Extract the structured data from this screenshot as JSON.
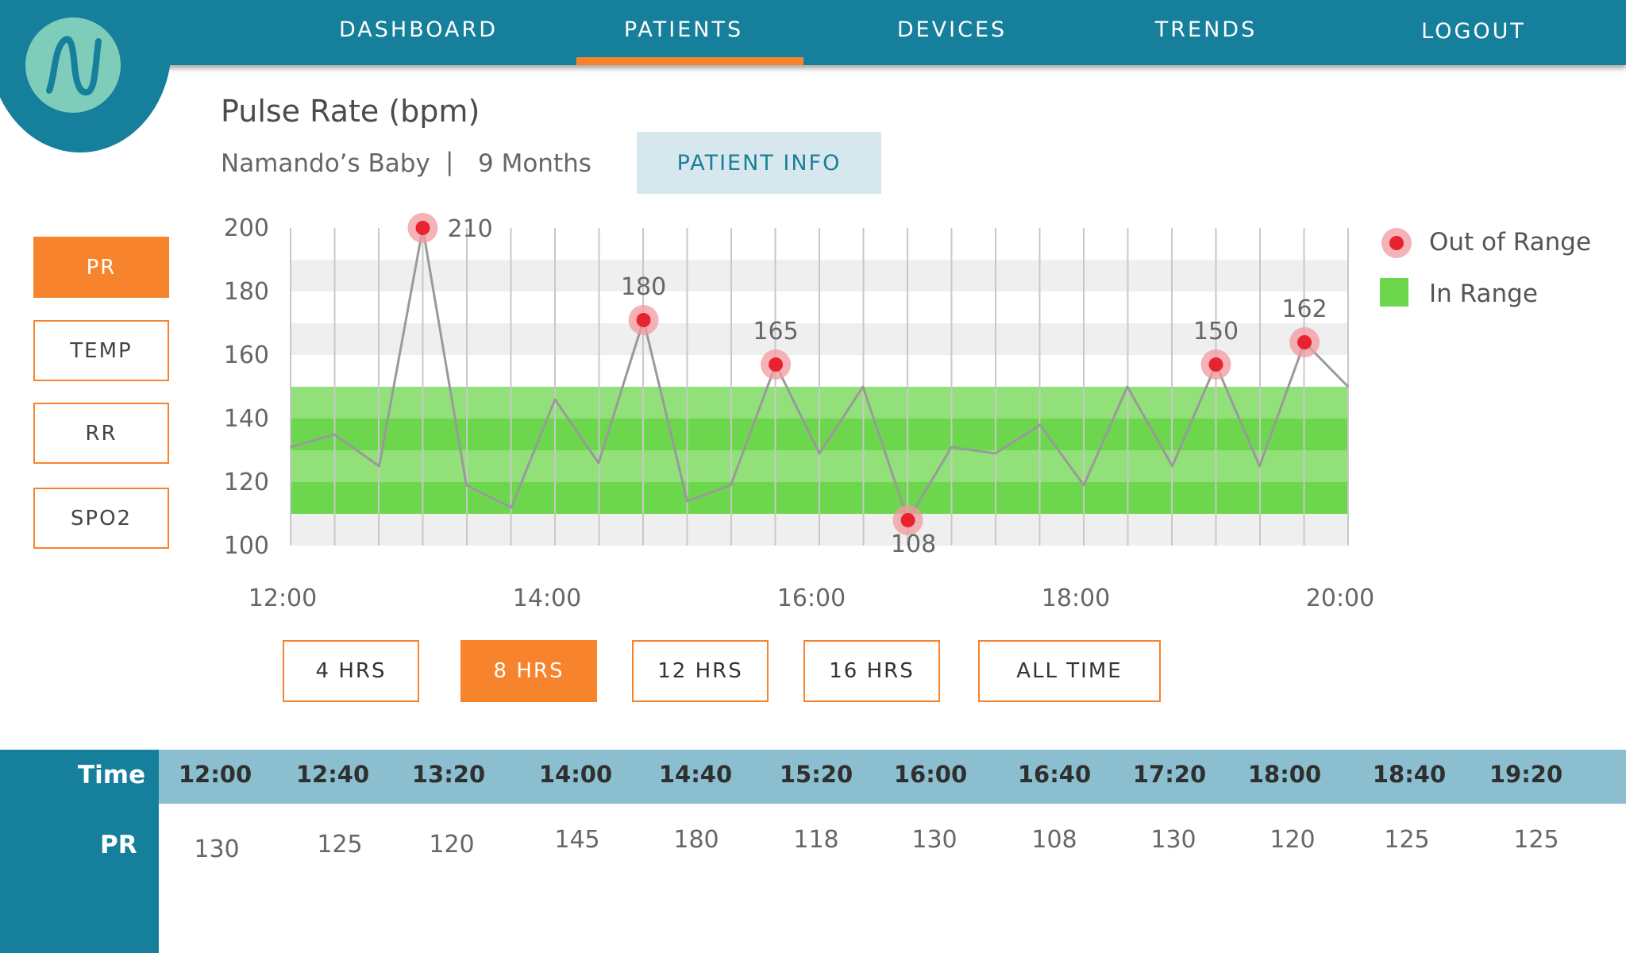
{
  "nav": {
    "items": [
      {
        "label": "DASHBOARD",
        "active": false
      },
      {
        "label": "PATIENTS",
        "active": true
      },
      {
        "label": "DEVICES",
        "active": false
      },
      {
        "label": "TRENDS",
        "active": false
      },
      {
        "label": "LOGOUT",
        "active": false
      }
    ]
  },
  "header": {
    "title": "Pulse Rate (bpm)",
    "patient_name": "Namando’s Baby",
    "separator": "|",
    "patient_age": "9 Months",
    "patient_info_label": "PATIENT INFO"
  },
  "metrics": [
    {
      "label": "PR",
      "active": true
    },
    {
      "label": "TEMP",
      "active": false
    },
    {
      "label": "RR",
      "active": false
    },
    {
      "label": "SPO2",
      "active": false
    }
  ],
  "legend": {
    "out_of_range": "Out of Range",
    "in_range": "In Range"
  },
  "colors": {
    "brand": "#167f9b",
    "accent": "#f7832c",
    "table_header": "#8bbfcf",
    "in_range_light": "#92e07a",
    "in_range_dark": "#6cd64c",
    "out_of_range_dot": "#e8232f",
    "out_of_range_halo": "#f29aa0",
    "line": "#9a9a9a"
  },
  "chart_data": {
    "type": "line",
    "ylim": [
      100,
      200
    ],
    "yticks": [
      100,
      120,
      140,
      160,
      180,
      200
    ],
    "x_tick_labels": [
      "12:00",
      "14:00",
      "16:00",
      "18:00",
      "20:00"
    ],
    "x_ticks_hours": [
      12,
      14,
      16,
      18,
      20
    ],
    "xlim_hours": [
      12,
      20
    ],
    "grid": true,
    "in_range": [
      110,
      150
    ],
    "series": [
      {
        "x_hours": [
          12.0,
          12.33,
          12.67,
          13.0,
          13.33,
          13.67,
          14.0,
          14.33,
          14.67,
          15.0,
          15.33,
          15.67,
          16.0,
          16.33,
          16.67,
          17.0,
          17.33,
          17.67,
          18.0,
          18.33,
          18.67,
          19.0,
          19.33,
          19.67,
          20.0
        ],
        "values": [
          131,
          135,
          125,
          200,
          119,
          112,
          146,
          126,
          171,
          114,
          119,
          157,
          129,
          150,
          108,
          131,
          129,
          138,
          119,
          150,
          125,
          157,
          125,
          164,
          150
        ]
      }
    ],
    "out_of_range_points": [
      {
        "x_hour": 13.0,
        "value": 200,
        "label": "210"
      },
      {
        "x_hour": 14.67,
        "value": 171,
        "label": "180"
      },
      {
        "x_hour": 15.67,
        "value": 157,
        "label": "165"
      },
      {
        "x_hour": 16.67,
        "value": 108,
        "label": "108"
      },
      {
        "x_hour": 19.0,
        "value": 157,
        "label": "150"
      },
      {
        "x_hour": 19.67,
        "value": 164,
        "label": "162"
      }
    ]
  },
  "ranges": [
    {
      "label": "4 HRS",
      "active": false
    },
    {
      "label": "8 HRS",
      "active": true
    },
    {
      "label": "12 HRS",
      "active": false
    },
    {
      "label": "16 HRS",
      "active": false
    },
    {
      "label": "ALL TIME",
      "active": false
    }
  ],
  "table": {
    "row_labels": [
      "Time",
      "PR"
    ],
    "times": [
      "12:00",
      "12:40",
      "13:20",
      "14:00",
      "14:40",
      "15:20",
      "16:00",
      "16:40",
      "17:20",
      "18:00",
      "18:40",
      "19:20"
    ],
    "pr_values": [
      "130",
      "125",
      "120",
      "145",
      "180",
      "118",
      "130",
      "108",
      "130",
      "120",
      "125",
      "125"
    ]
  }
}
